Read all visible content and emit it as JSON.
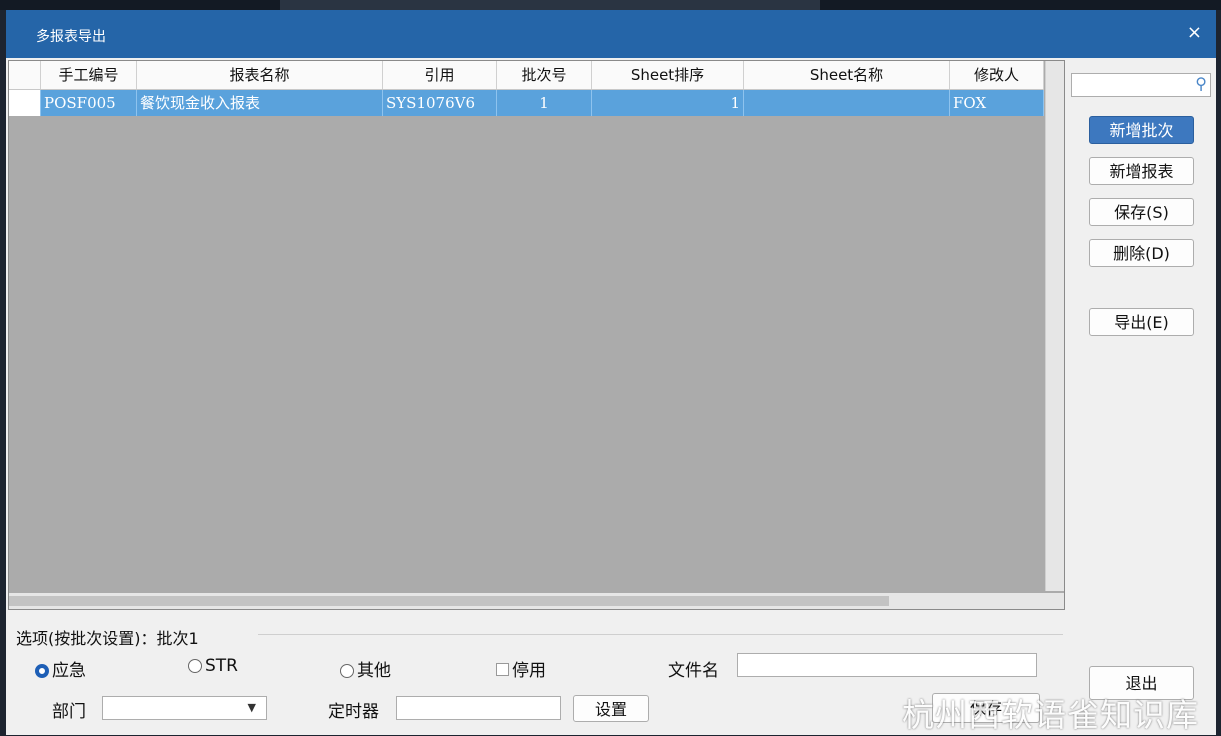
{
  "window": {
    "title": "多报表导出",
    "close_icon": "×"
  },
  "grid": {
    "columns": [
      "手工编号",
      "报表名称",
      "引用",
      "批次号",
      "Sheet排序",
      "Sheet名称",
      "修改人"
    ],
    "rows": [
      {
        "manual_no": "POSF005",
        "report_name": "餐饮现金收入报表",
        "ref": "SYS1076V6",
        "batch": "1",
        "sheet_order": "1",
        "sheet_name": "",
        "modifier": "FOX"
      }
    ]
  },
  "search": {
    "icon": "search-icon",
    "value": ""
  },
  "buttons": {
    "add_batch": "新增批次",
    "add_report": "新增报表",
    "save": "保存(S)",
    "delete": "删除(D)",
    "export": "导出(E)",
    "exit": "退出",
    "save_bottom": "保存",
    "settings": "设置"
  },
  "options": {
    "legend": "选项(按批次设置)：批次1",
    "radio_urgent": "应急",
    "radio_str": "STR",
    "radio_other": "其他",
    "check_disabled": "停用",
    "filename_label": "文件名",
    "filename_value": "",
    "dept_label": "部门",
    "dept_value": "",
    "timer_label": "定时器",
    "timer_value": ""
  },
  "watermark": "杭州西软语雀知识库",
  "colors": {
    "titlebar": "#2565a8",
    "selected_row": "#5aa2dc",
    "primary_button": "#3d78bf"
  }
}
